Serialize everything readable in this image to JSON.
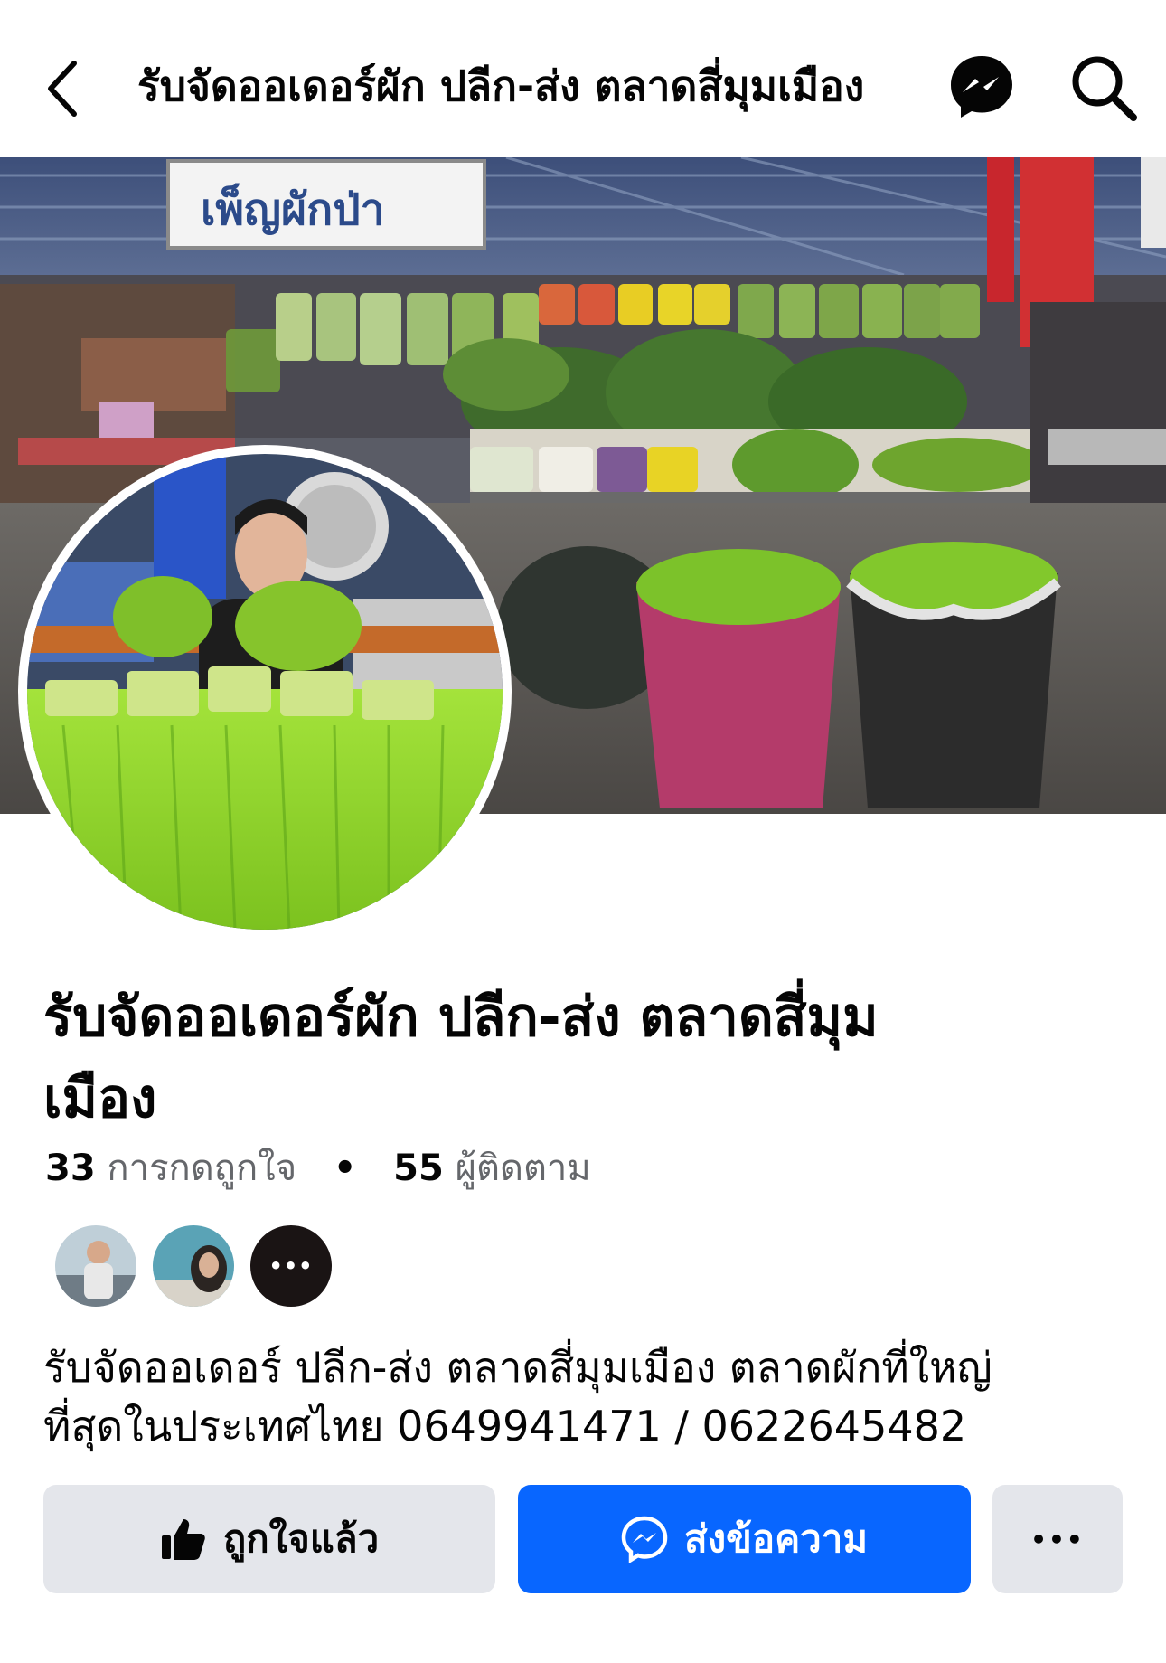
{
  "header": {
    "title": "รับจัดออเดอร์ผัก ปลีก-ส่ง ตลาดสี่มุมเมือง"
  },
  "cover": {
    "sign_text": "เพ็ญผักป่า"
  },
  "profile": {
    "name": "รับจัดออเดอร์ผัก ปลีก-ส่ง ตลาดสี่มุม\nเมือง",
    "likes_count": "33",
    "likes_label": "การกดถูกใจ",
    "separator": "•",
    "followers_count": "55",
    "followers_label": "ผู้ติดตาม",
    "more_friends_glyph": "•••",
    "about": "รับจัดออเดอร์ ปลีก-ส่ง ตลาดสี่มุมเมือง ตลาดผักที่ใหญ่\nที่สุดในประเทศไทย 0649941471 / 0622645482"
  },
  "actions": {
    "like_label": "ถูกใจแล้ว",
    "message_label": "ส่งข้อความ",
    "more_glyph": "•••"
  },
  "colors": {
    "accent": "#0866ff",
    "button_gray": "#e4e6eb",
    "secondary_text": "#65676b"
  },
  "icons": [
    "back-arrow-icon",
    "messenger-icon",
    "search-icon",
    "thumbs-up-icon",
    "more-icon"
  ]
}
